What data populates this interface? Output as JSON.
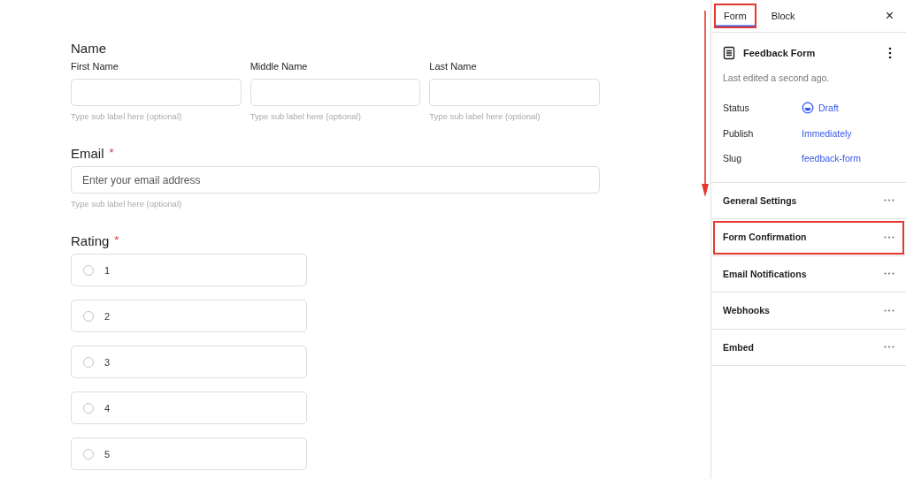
{
  "form": {
    "fields": [
      {
        "kind": "name",
        "label": "Name",
        "parts": [
          {
            "label": "First Name",
            "hint": "Type sub label here (optional)"
          },
          {
            "label": "Middle Name",
            "hint": "Type sub label here (optional)"
          },
          {
            "label": "Last Name",
            "hint": "Type sub label here (optional)"
          }
        ]
      },
      {
        "kind": "email",
        "label": "Email",
        "required_mark": "*",
        "placeholder": "Enter your email address",
        "hint": "Type sub label here (optional)"
      },
      {
        "kind": "radio",
        "label": "Rating",
        "required_mark": "*",
        "options": [
          {
            "label": "1",
            "selected": false
          },
          {
            "label": "2",
            "selected": false
          },
          {
            "label": "3",
            "selected": false
          },
          {
            "label": "4",
            "selected": false
          },
          {
            "label": "5",
            "selected": false
          }
        ]
      }
    ]
  },
  "sidebar": {
    "tabs": [
      {
        "label": "Form",
        "selected": true,
        "highlighted": true
      },
      {
        "label": "Block",
        "selected": false,
        "highlighted": false
      }
    ],
    "close": "×",
    "document": {
      "title": "Feedback Form",
      "edited": "Last edited a second ago.",
      "meta": [
        {
          "label": "Status",
          "value": "Draft",
          "kind": "status"
        },
        {
          "label": "Publish",
          "value": "Immediately",
          "kind": "link"
        },
        {
          "label": "Slug",
          "value": "feedback-form",
          "kind": "link"
        }
      ]
    },
    "sections": [
      {
        "label": "General Settings",
        "highlighted": false
      },
      {
        "label": "Form Confirmation",
        "highlighted": true
      },
      {
        "label": "Email Notifications",
        "highlighted": false
      },
      {
        "label": "Webhooks",
        "highlighted": false
      },
      {
        "label": "Embed",
        "highlighted": false
      }
    ]
  }
}
